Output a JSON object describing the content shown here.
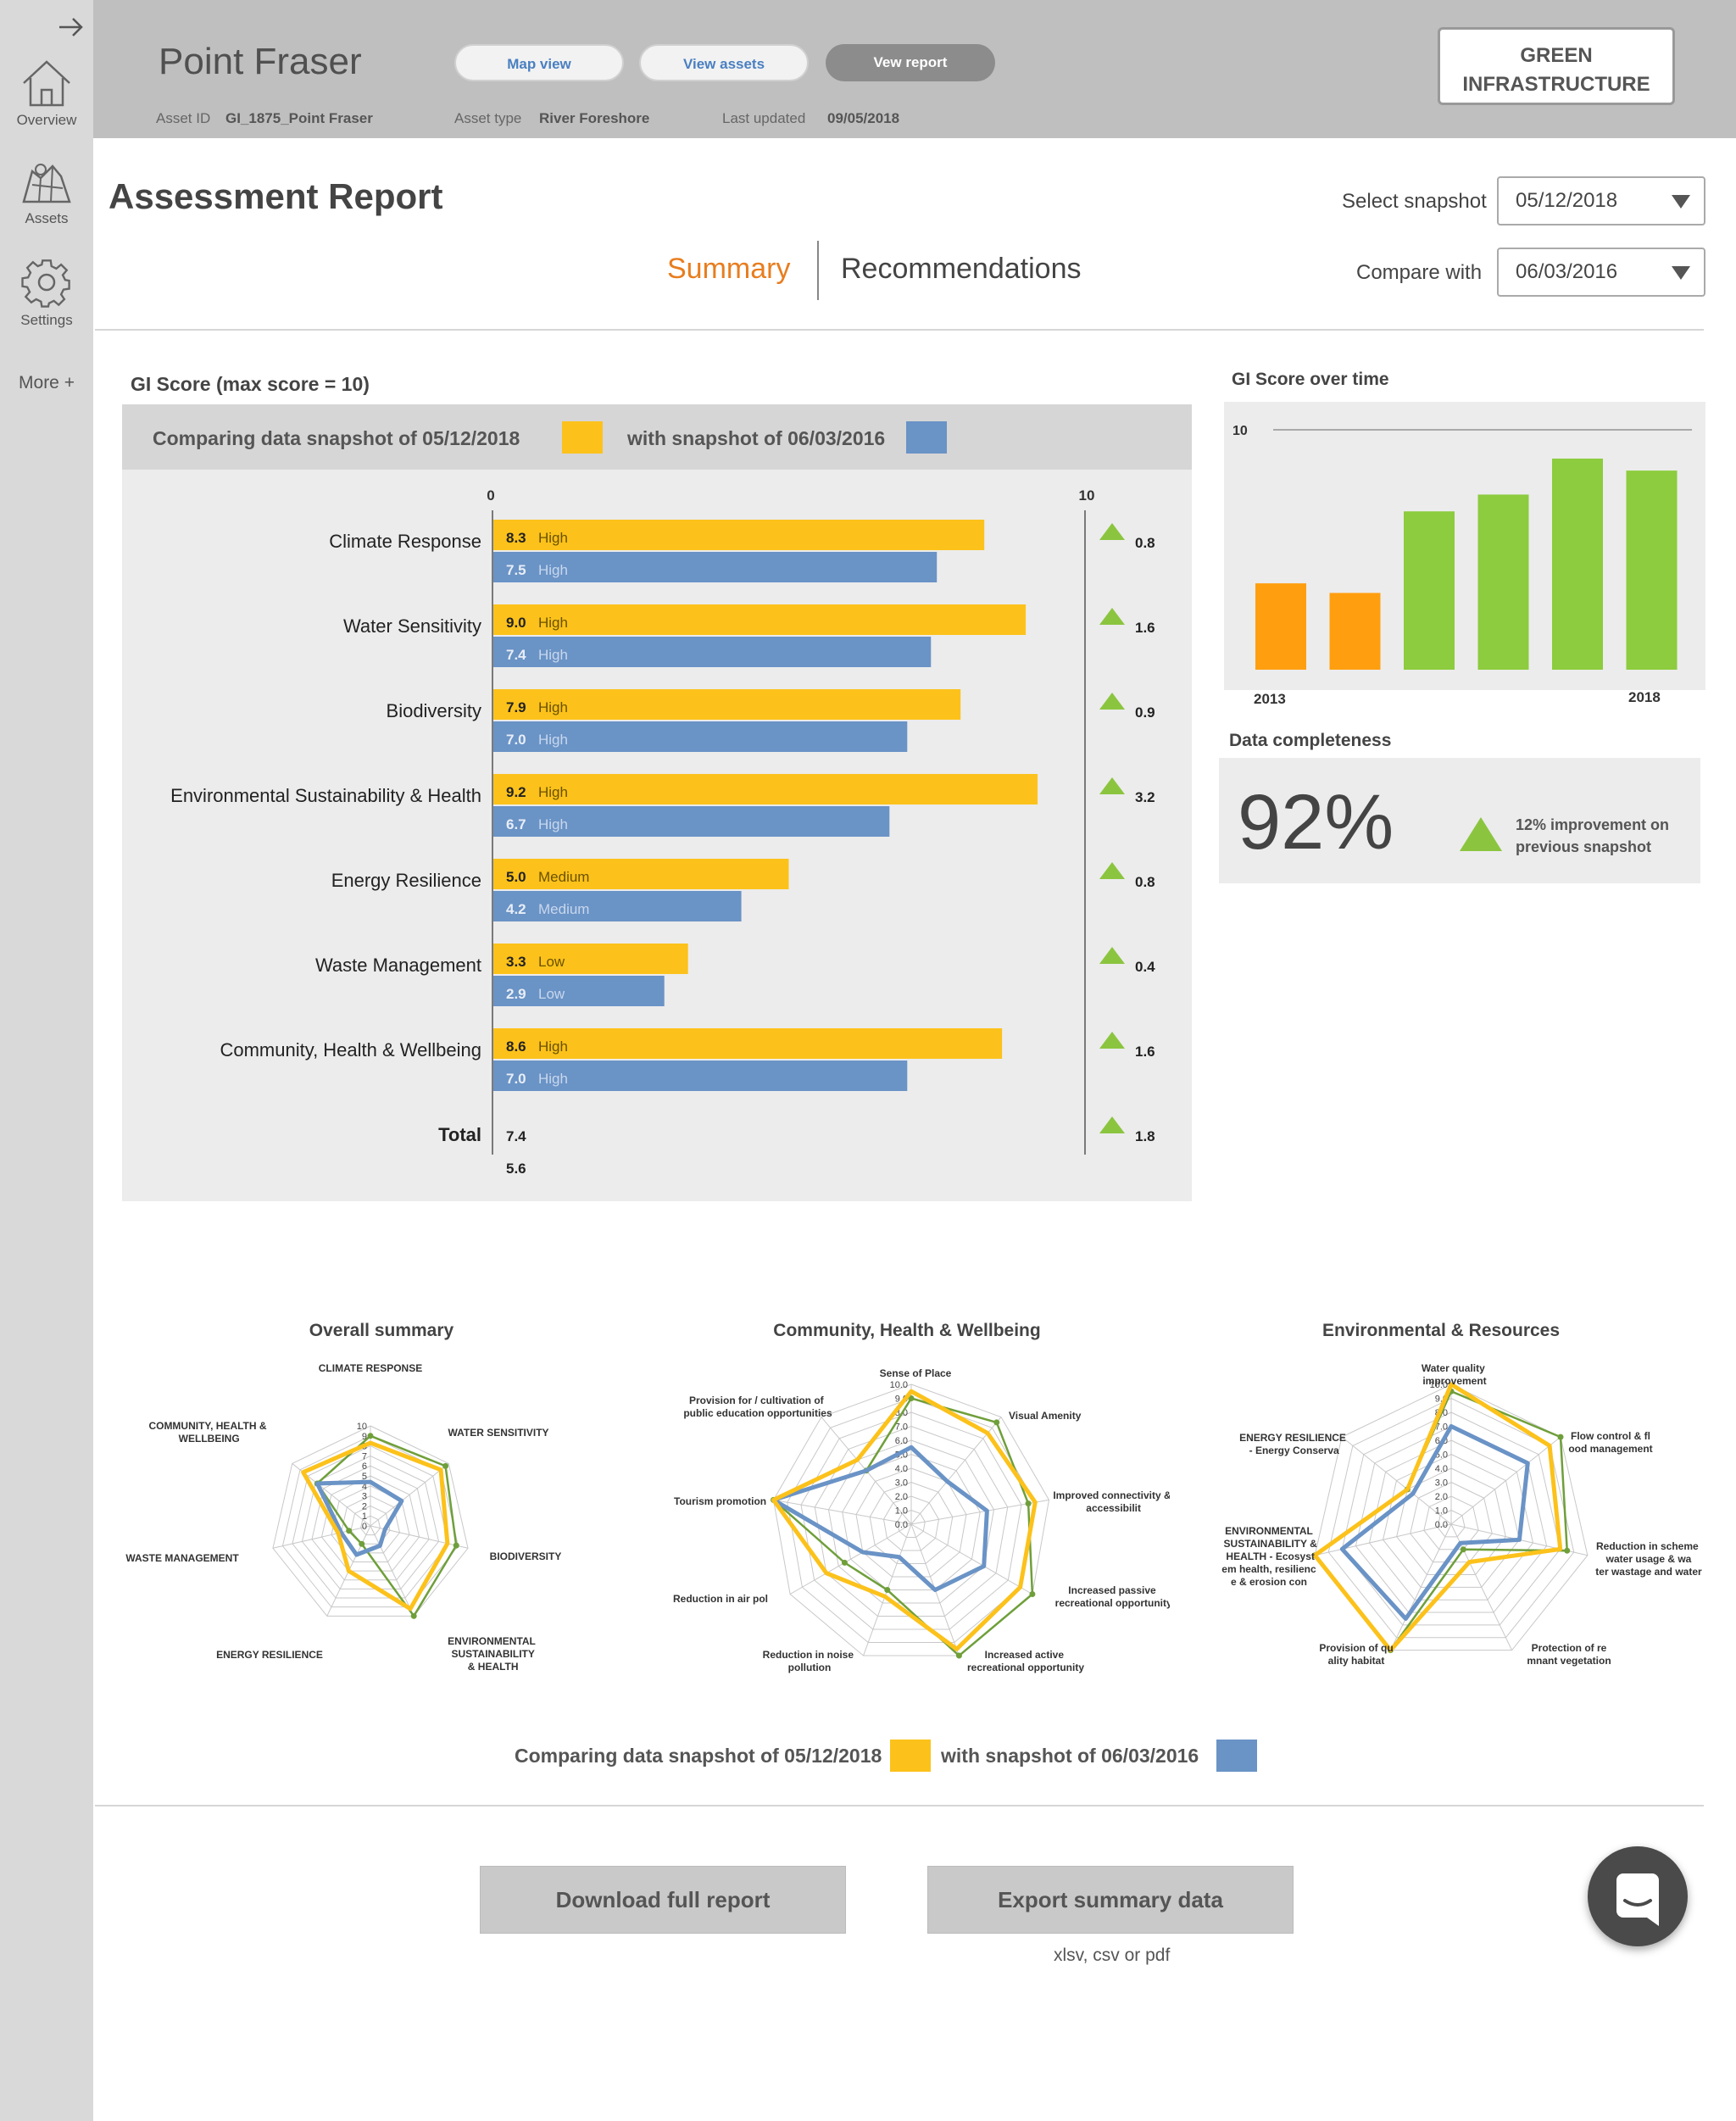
{
  "sidebar": {
    "items": [
      {
        "label": "Overview",
        "icon": "home-icon"
      },
      {
        "label": "Assets",
        "icon": "map-icon"
      },
      {
        "label": "Settings",
        "icon": "gear-icon"
      }
    ],
    "more": "More +"
  },
  "header": {
    "asset_name": "Point Fraser",
    "buttons": {
      "map_view": "Map view",
      "view_assets": "View assets",
      "view_report": "Vew report"
    },
    "meta": {
      "asset_id_label": "Asset ID",
      "asset_id": "GI_1875_Point Fraser",
      "asset_type_label": "Asset type",
      "asset_type": "River Foreshore",
      "last_updated_label": "Last updated",
      "last_updated": "09/05/2018"
    },
    "brand_line1": "GREEN",
    "brand_line2": "INFRASTRUCTURE"
  },
  "report": {
    "title": "Assessment Report",
    "tabs": {
      "summary": "Summary",
      "recommendations": "Recommendations"
    },
    "select_snapshot_label": "Select snapshot",
    "select_snapshot_value": "05/12/2018",
    "compare_with_label": "Compare with",
    "compare_with_value": "06/03/2016"
  },
  "colors": {
    "current": "#fcc21b",
    "previous": "#6a93c6",
    "up": "#8bc53f",
    "orange": "#ff9f0f",
    "green": "#8ccc3e"
  },
  "gi_score": {
    "title": "GI Score (max score = 10)",
    "legend_current": "Comparing data snapshot of 05/12/2018",
    "legend_previous": "with snapshot of 06/03/2016",
    "axis_min": "0",
    "axis_max": "10",
    "total_label": "Total",
    "total_current": "7.4",
    "total_previous": "5.6",
    "total_change": "1.8"
  },
  "chart_data": [
    {
      "type": "bar",
      "title": "GI Score (max score = 10)",
      "xlim": [
        0,
        10
      ],
      "categories": [
        "Climate Response",
        "Water Sensitivity",
        "Biodiversity",
        "Environmental Sustainability & Health",
        "Energy Resilience",
        "Waste Management",
        "Community, Health & Wellbeing"
      ],
      "series": [
        {
          "name": "Comparing data snapshot of 05/12/2018",
          "values": [
            8.3,
            9.0,
            7.9,
            9.2,
            5.0,
            3.3,
            8.6
          ],
          "ratings": [
            "High",
            "High",
            "High",
            "High",
            "Medium",
            "Low",
            "High"
          ],
          "labels": [
            "8.3",
            "9.0",
            "7.9",
            "9.2",
            "5.0",
            "3.3",
            "8.6"
          ]
        },
        {
          "name": "with snapshot of 06/03/2016",
          "values": [
            7.5,
            7.4,
            7.0,
            6.7,
            4.2,
            2.9,
            7.0
          ],
          "ratings": [
            "High",
            "High",
            "High",
            "High",
            "Medium",
            "Low",
            "High"
          ],
          "labels": [
            "7.5",
            "7.4",
            "7.0",
            "6.7",
            "4.2",
            "2.9",
            "7.0"
          ]
        }
      ],
      "changes": [
        "0.8",
        "1.6",
        "0.9",
        "3.2",
        "0.8",
        "0.4",
        "1.6"
      ]
    },
    {
      "type": "bar",
      "title": "GI Score over time",
      "x_first_label": "2013",
      "x_last_label": "2018",
      "y_tick": "10",
      "ylim": [
        0,
        10
      ],
      "values": [
        3.6,
        3.2,
        6.6,
        7.3,
        8.8,
        8.3
      ],
      "colors": [
        "#ff9f0f",
        "#ff9f0f",
        "#8ccc3e",
        "#8ccc3e",
        "#8ccc3e",
        "#8ccc3e"
      ]
    },
    {
      "type": "radar",
      "title": "Overall summary",
      "rmax": 10,
      "ticks": [
        "0",
        "1",
        "2",
        "3",
        "4",
        "5",
        "6",
        "7",
        "8",
        "9",
        "10"
      ],
      "axes": [
        "CLIMATE RESPONSE",
        "WATER  SENSITIVITY",
        "BIODIVERSITY",
        "ENVIRONMENTAL SUSTAINABILITY & HEALTH",
        "ENERGY  RESILIENCE",
        "WASTE  MANAGEMENT",
        "COMMUNITY, HEALTH & WELLBEING"
      ],
      "series": [
        {
          "name": "05/12/2018",
          "values": [
            8.3,
            9.0,
            7.9,
            9.2,
            5.0,
            3.3,
            8.6
          ]
        },
        {
          "name": "06/03/2016",
          "values": [
            4.4,
            4.0,
            1.5,
            2.2,
            3.2,
            3.0,
            6.8
          ]
        },
        {
          "name": "green",
          "values": [
            9.0,
            9.6,
            8.8,
            10.0,
            2.0,
            2.2,
            6.8
          ]
        }
      ]
    },
    {
      "type": "radar",
      "title": "Community, Health & Wellbeing",
      "rmax": 10,
      "ticks": [
        "0.0",
        "1.0",
        "2.0",
        "3.0",
        "4.0",
        "5.0",
        "6.0",
        "7.0",
        "8.0",
        "9.0",
        "10.0"
      ],
      "axes": [
        "Sense of Place",
        "Visual Amenity",
        "Improved  connectivity & accessibility",
        "Increased passive recreational opportunity",
        "Increased active recreational opportunity",
        "Reduction in  noise pollution",
        "Reduction in air  pollution",
        "Tourism promotion",
        "Provision for / cultivation of  public education opportunities"
      ],
      "series": [
        {
          "name": "05/12/2018",
          "values": [
            9.5,
            8.5,
            9.0,
            9.0,
            9.5,
            5.5,
            7.0,
            10.0,
            6.0
          ]
        },
        {
          "name": "06/03/2016",
          "values": [
            5.5,
            4.0,
            5.5,
            6.0,
            5.0,
            2.5,
            4.0,
            10.0,
            5.0
          ]
        },
        {
          "name": "green",
          "values": [
            9.0,
            9.5,
            8.5,
            10.0,
            10.0,
            5.0,
            5.5,
            10.0,
            5.0
          ]
        }
      ]
    },
    {
      "type": "radar",
      "title": "Environmental & Resources",
      "rmax": 10,
      "ticks": [
        "0.0",
        "1.0",
        "2.0",
        "3.0",
        "4.0",
        "5.0",
        "6.0",
        "7.0",
        "8.0",
        "9.0",
        "10.0"
      ],
      "axes": [
        "Water quality improvement",
        "Flow control & flood management",
        "Reduction in  scheme water usage &  water wastage and  water reuse",
        "Protection of remnant vegetation",
        "Provision of  quality habitat",
        "ENVIRONMENTAL SUSTAINABILITY & HEALTH - Ecosystem health, resilience & erosion control",
        "ENERGY  RESILIENCE - Energy Conservation"
      ],
      "series": [
        {
          "name": "05/12/2018",
          "values": [
            10.0,
            9.0,
            8.0,
            3.0,
            10.0,
            10.0,
            4.0
          ]
        },
        {
          "name": "06/03/2016",
          "values": [
            7.0,
            7.0,
            5.0,
            1.5,
            7.5,
            8.0,
            3.5
          ]
        },
        {
          "name": "green",
          "values": [
            9.5,
            10.0,
            8.5,
            2.0,
            10.0,
            10.0,
            4.0
          ]
        }
      ]
    }
  ],
  "score_over_time": {
    "title": "GI Score over time"
  },
  "completeness": {
    "title": "Data completeness",
    "value": "92%",
    "note_line1": "12% improvement on",
    "note_line2": "previous snapshot"
  },
  "radar_legend": {
    "current": "Comparing data snapshot of 05/12/2018",
    "previous": "with snapshot of 06/03/2016"
  },
  "actions": {
    "download": "Download full report",
    "export": "Export summary data",
    "export_note": "xlsv, csv or pdf"
  }
}
